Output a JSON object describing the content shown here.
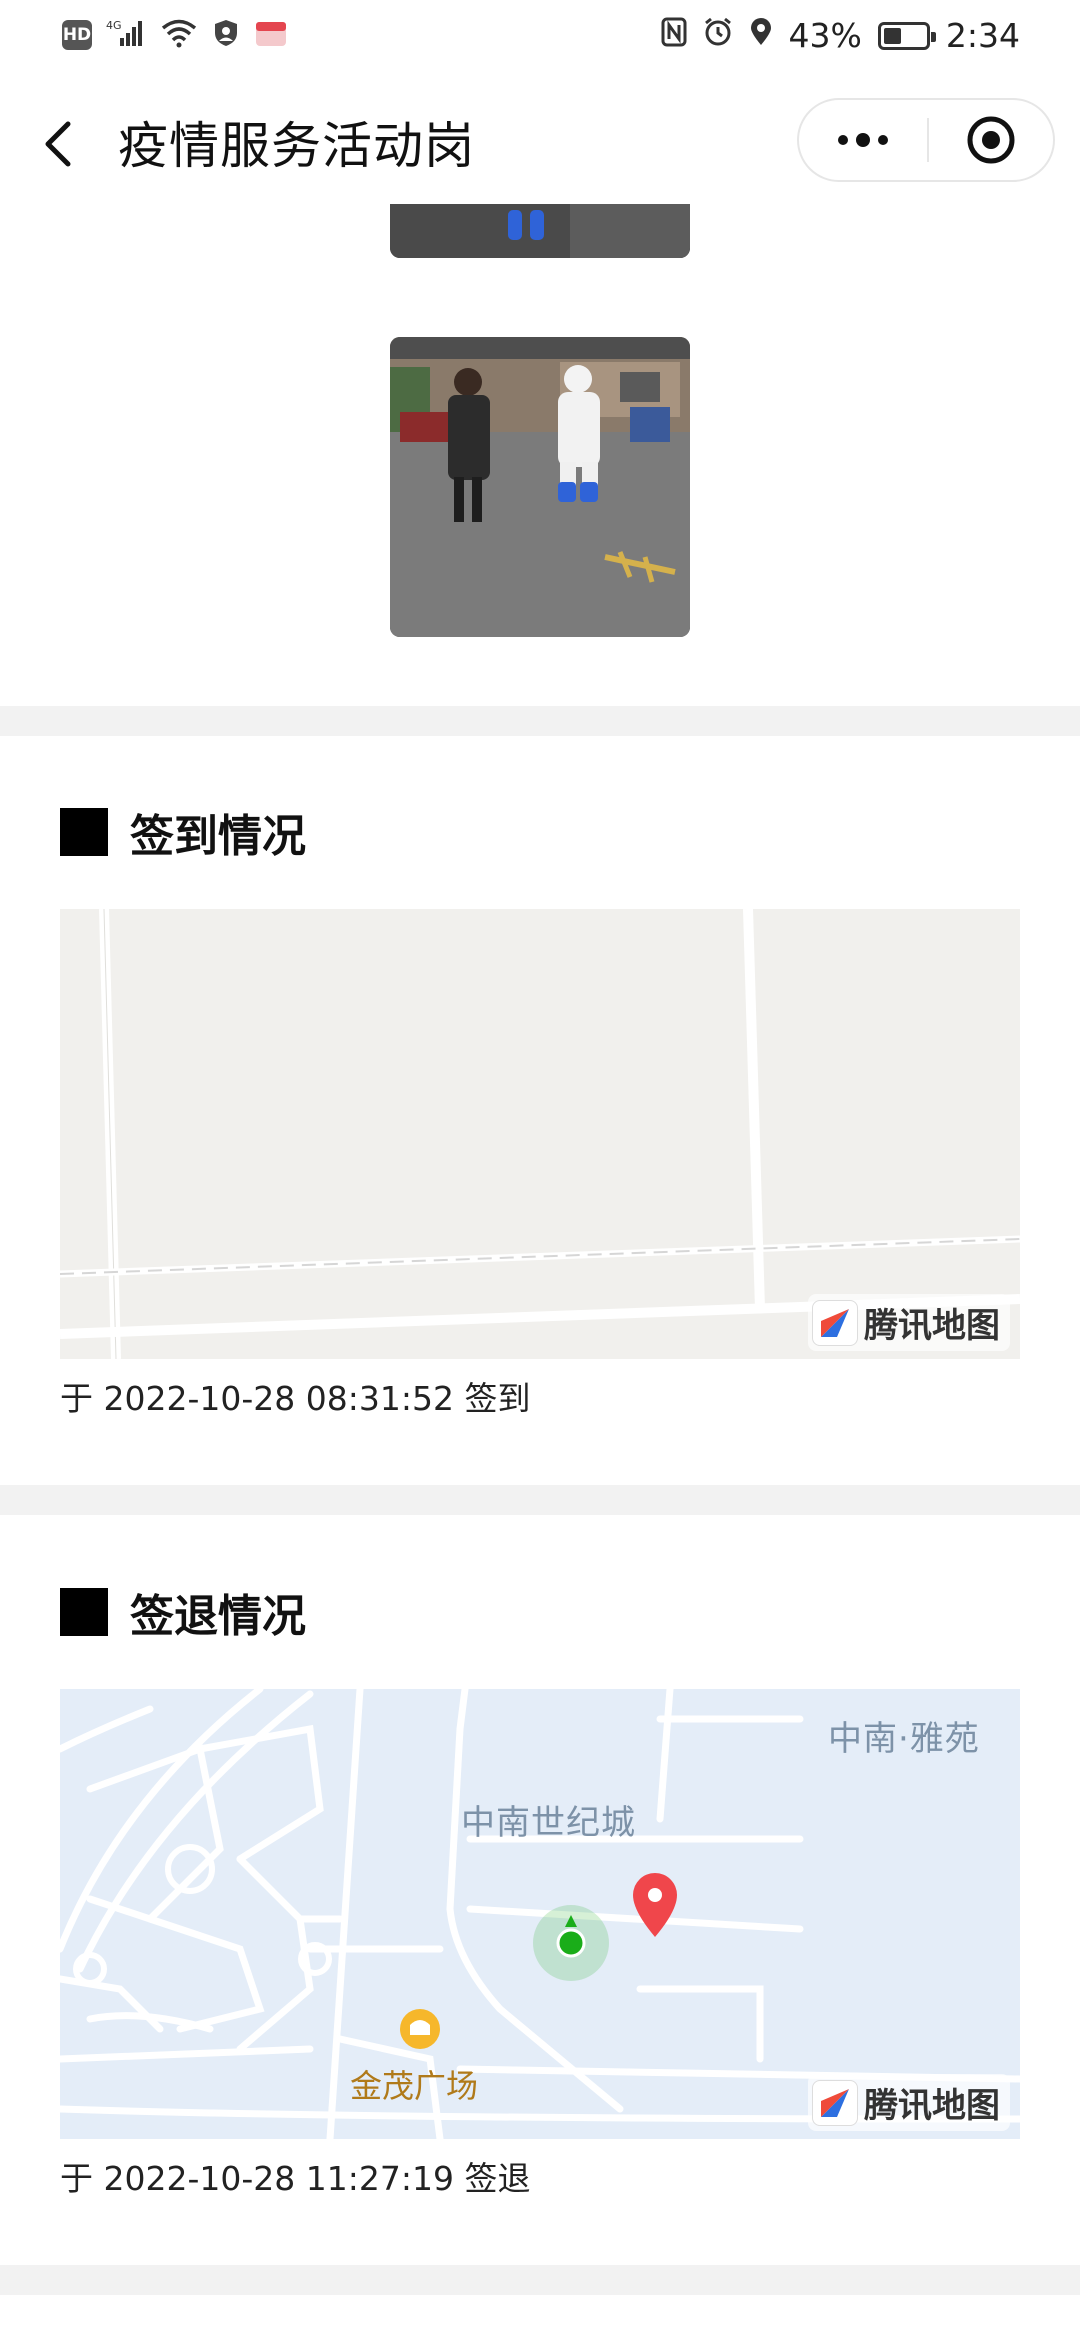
{
  "status_bar": {
    "hd_label": "HD",
    "network_label": "4G",
    "battery_text": "43%",
    "battery_level": 0.43,
    "time": "2:34"
  },
  "nav": {
    "title": "疫情服务活动岗",
    "capsule_more_icon": "more-dots-icon",
    "capsule_close_icon": "target-circle-icon"
  },
  "checkin": {
    "title": "签到情况",
    "record": "于 2022-10-28 08:31:52 签到",
    "map_brand": "腾讯地图"
  },
  "checkout": {
    "title": "签退情况",
    "record": "于 2022-10-28 11:27:19 签退",
    "map_brand": "腾讯地图",
    "labels": {
      "area1": "中南·雅苑",
      "area2": "中南世纪城",
      "poi": "金茂广场"
    }
  },
  "colors": {
    "section_gap": "#f2f2f2",
    "map_checkin_bg": "#f1f0ed",
    "map_checkout_bg": "#e4edf8",
    "location_dot": "#1aad19",
    "pin": "#f0464b"
  }
}
